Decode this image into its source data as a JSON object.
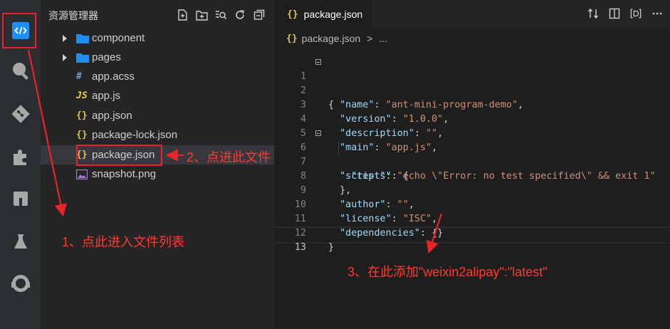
{
  "sidebar": {
    "title": "资源管理器",
    "files": [
      {
        "name": "component",
        "type": "folder"
      },
      {
        "name": "pages",
        "type": "folder"
      },
      {
        "name": "app.acss",
        "type": "acss",
        "icon": "#"
      },
      {
        "name": "app.js",
        "type": "js",
        "icon": "JS"
      },
      {
        "name": "app.json",
        "type": "json",
        "icon": "{}"
      },
      {
        "name": "package-lock.json",
        "type": "json",
        "icon": "{}"
      },
      {
        "name": "package.json",
        "type": "json",
        "icon": "{}"
      },
      {
        "name": "snapshot.png",
        "type": "image"
      }
    ]
  },
  "editor": {
    "tab_label": "package.json",
    "tab_icon": "{}",
    "breadcrumb_file": "package.json",
    "breadcrumb_sep": ">",
    "breadcrumb_more": "...",
    "lines": [
      {
        "n": "1",
        "code": "{"
      },
      {
        "n": "2",
        "key": "\"name\"",
        "sep": ": ",
        "val": "\"ant-mini-program-demo\"",
        "end": ","
      },
      {
        "n": "3",
        "key": "\"version\"",
        "sep": ": ",
        "val": "\"1.0.0\"",
        "end": ","
      },
      {
        "n": "4",
        "key": "\"description\"",
        "sep": ": ",
        "val": "\"\"",
        "end": ","
      },
      {
        "n": "5",
        "key": "\"main\"",
        "sep": ": ",
        "val": "\"app.js\"",
        "end": ","
      },
      {
        "n": "6",
        "key": "\"scripts\"",
        "sep": ": ",
        "val": "",
        "end": "{"
      },
      {
        "n": "7",
        "key": "\"test\"",
        "sep": ": ",
        "val": "\"echo \\\"Error: no test specified\\\" && exit 1\"",
        "end": ""
      },
      {
        "n": "8",
        "code": "},"
      },
      {
        "n": "9",
        "key": "\"author\"",
        "sep": ": ",
        "val": "\"\"",
        "end": ","
      },
      {
        "n": "10",
        "key": "\"license\"",
        "sep": ": ",
        "val": "\"ISC\"",
        "end": ","
      },
      {
        "n": "11",
        "key": "\"dependencies\"",
        "sep": ": ",
        "val": "",
        "end": "{}"
      },
      {
        "n": "12",
        "code": "}"
      },
      {
        "n": "13",
        "code": ""
      }
    ]
  },
  "annotations": {
    "step1": "1、点此进入文件列表",
    "step2": "2、点进此文件",
    "step3": "3、在此添加\"weixin2alipay\":\"latest\""
  },
  "colors": {
    "accent_blue": "#1e8ff5",
    "annotation_red": "#e5252a",
    "json_key": "#9cdcfe",
    "json_string": "#ce9178",
    "json_icon": "#d6c55c"
  }
}
